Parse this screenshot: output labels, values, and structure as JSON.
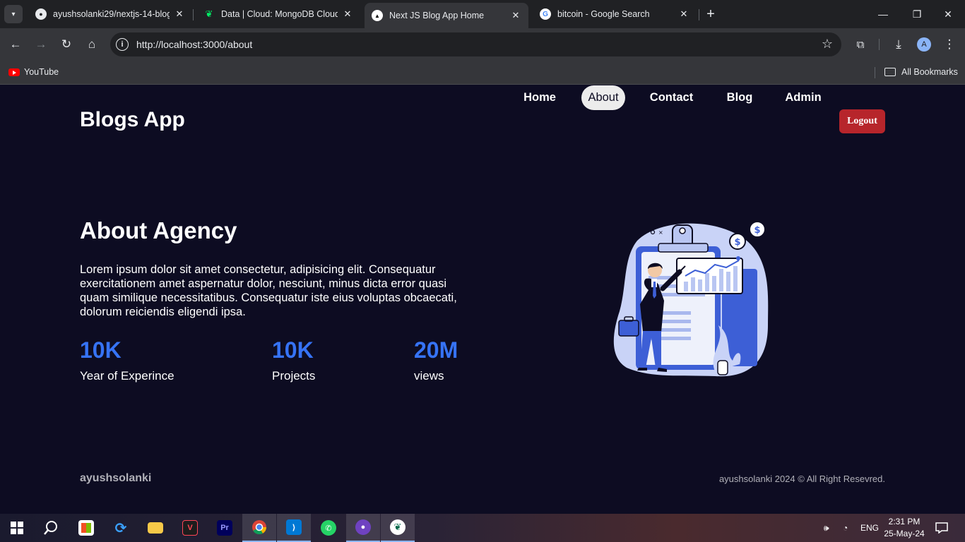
{
  "browser": {
    "tabs": [
      {
        "title": "ayushsolanki29/nextjs-14-blogapp",
        "favicon": "github-icon"
      },
      {
        "title": "Data | Cloud: MongoDB Cloud",
        "favicon": "mongodb-leaf-icon"
      },
      {
        "title": "Next JS Blog App Home",
        "favicon": "nextjs-triangle-icon"
      },
      {
        "title": "bitcoin - Google Search",
        "favicon": "google-icon"
      }
    ],
    "url": "http://localhost:3000/about",
    "profile_initial": "A",
    "bookmarks": {
      "youtube": "YouTube",
      "all": "All Bookmarks"
    }
  },
  "site": {
    "logo": "Blogs App",
    "nav": [
      "Home",
      "About",
      "Contact",
      "Blog",
      "Admin"
    ],
    "active_nav": "About",
    "logout_label": "Logout",
    "accent_color": "#3673f5",
    "logout_color": "#b7252b",
    "background_color": "#0d0c22"
  },
  "about": {
    "title": "About Agency",
    "description": "Lorem ipsum dolor sit amet consectetur, adipisicing elit. Consequatur exercitationem amet aspernatur dolor, nesciunt, minus dicta error quasi quam similique necessitatibus. Consequatur iste eius voluptas obcaecati, dolorum reiciendis eligendi ipsa.",
    "stats": [
      {
        "value": "10K",
        "label": "Year of Experince"
      },
      {
        "value": "10K",
        "label": "Projects"
      },
      {
        "value": "20M",
        "label": "views"
      }
    ],
    "illustration": "businessman-presenting-chart-illustration"
  },
  "footer": {
    "name": "ayushsolanki",
    "copyright": "ayushsolanki 2024 © All Right Resevred."
  },
  "taskbar": {
    "apps": [
      "windows-start-icon",
      "search-icon",
      "store-icon",
      "sync-icon",
      "file-explorer-icon",
      "valorant-icon",
      "premiere-pro-icon",
      "chrome-icon",
      "vscode-icon",
      "whatsapp-icon",
      "github-desktop-icon",
      "mongodb-compass-icon"
    ],
    "language": "ENG",
    "time": "2:31 PM",
    "date": "25-May-24"
  }
}
